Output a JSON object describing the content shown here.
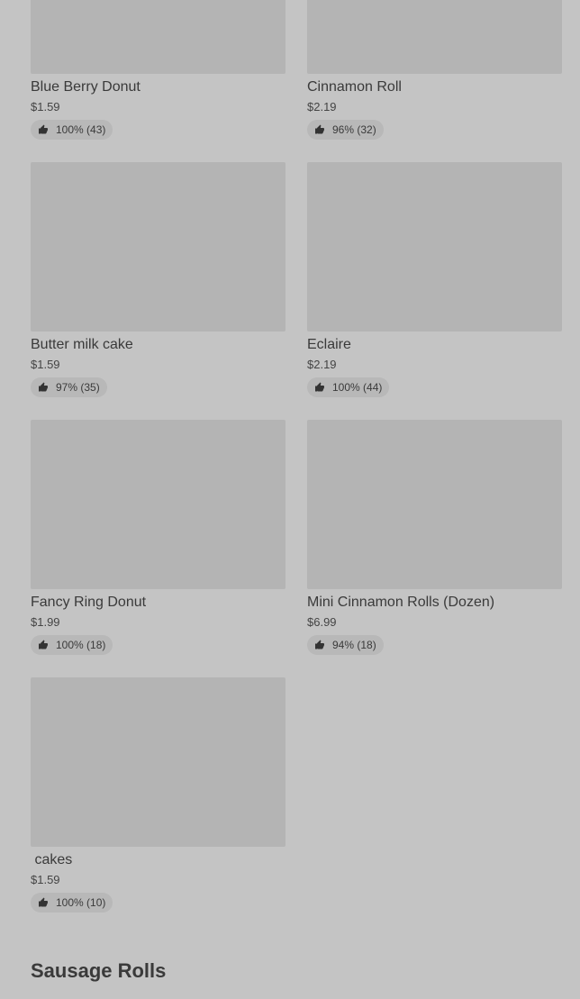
{
  "items": [
    {
      "name": "Blue Berry Donut",
      "price": "$1.59",
      "rating": "100% (43)"
    },
    {
      "name": "Cinnamon Roll",
      "price": "$2.19",
      "rating": "96% (32)"
    },
    {
      "name": "Butter milk cake",
      "price": "$1.59",
      "rating": "97% (35)"
    },
    {
      "name": "Eclaire",
      "price": "$2.19",
      "rating": "100% (44)"
    },
    {
      "name": "Fancy Ring Donut",
      "price": "$1.99",
      "rating": "100% (18)"
    },
    {
      "name": "Mini Cinnamon Rolls (Dozen)",
      "price": "$6.99",
      "rating": "94% (18)"
    },
    {
      "name": " cakes",
      "price": "$1.59",
      "rating": "100% (10)"
    }
  ],
  "section": {
    "title": "Sausage Rolls"
  },
  "icons": {
    "rating": "thumbs-up-icon"
  },
  "colors": {
    "background": "#c4c4c4",
    "image_placeholder": "#b4b4b4",
    "rating_pill": "#b8b8b8",
    "text": "#333333"
  }
}
